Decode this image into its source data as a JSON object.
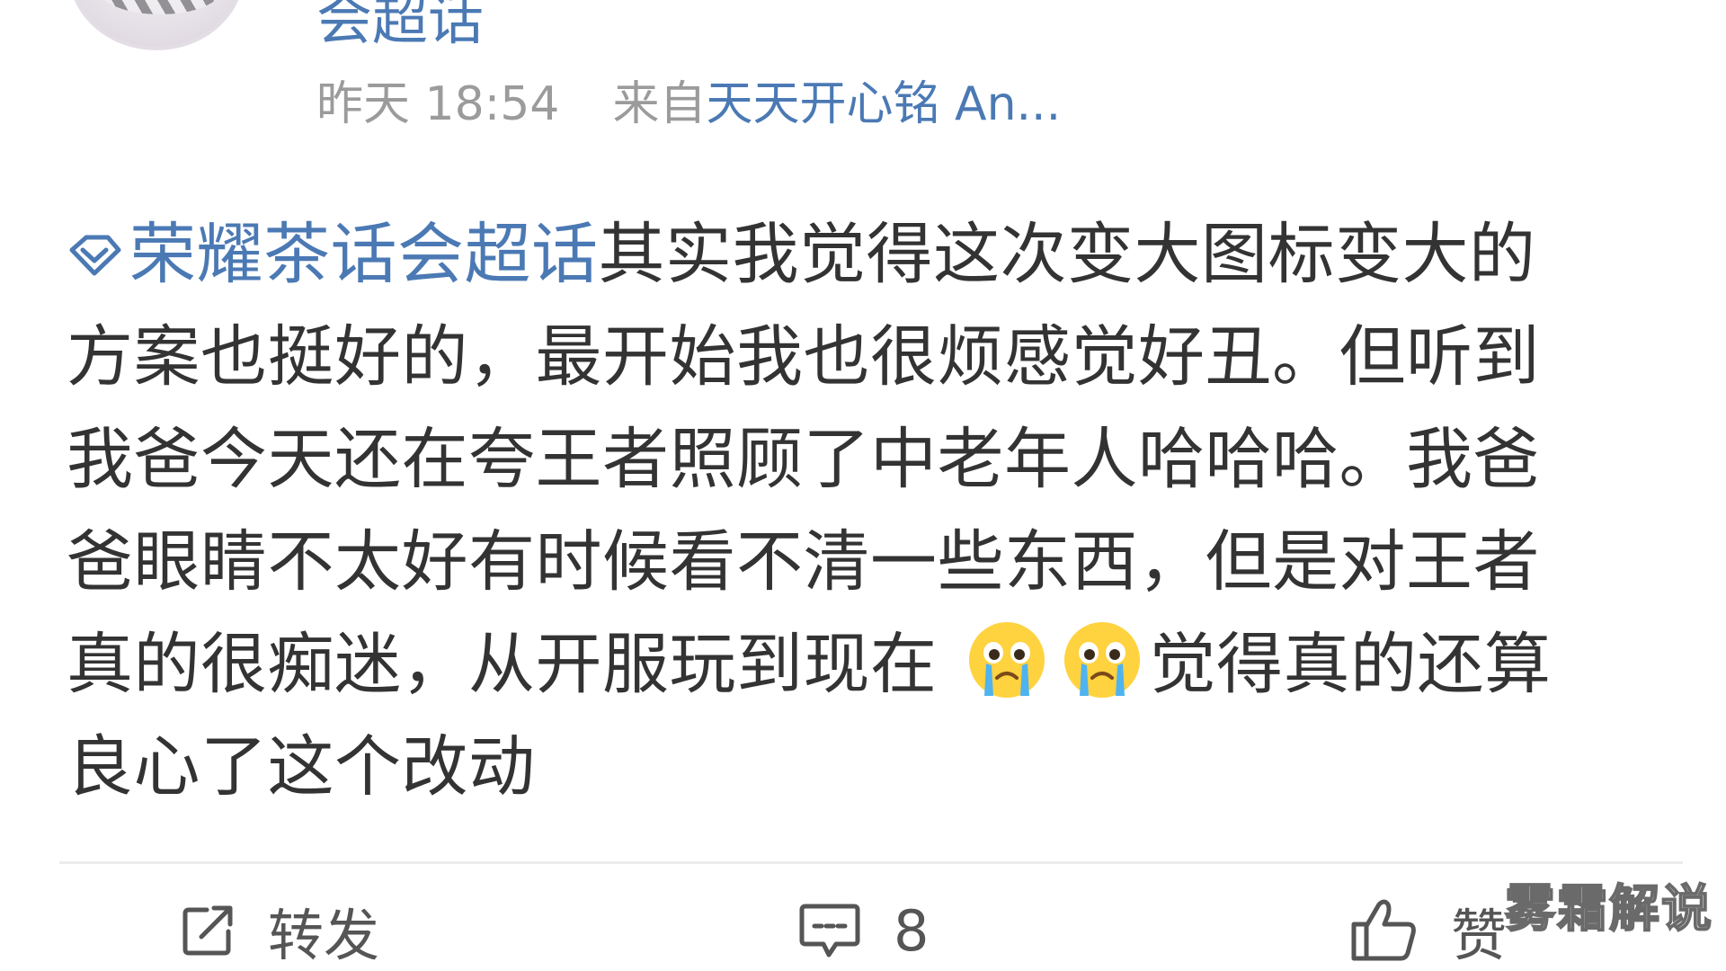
{
  "header": {
    "author_name": "会超话",
    "time": "昨天 18:54",
    "source_prefix": "来自",
    "source_name": "天天开心铭 An..."
  },
  "post": {
    "topic": "荣耀茶话会超话",
    "lines": [
      "其实我觉得这次变大图标变大的",
      "方案也挺好的，最开始我也很烦感觉好丑。但听到",
      "我爸今天还在夸王者照顾了中老年人哈哈哈。我爸",
      "爸眼睛不太好有时候看不清一些东西，但是对王者",
      "真的很痴迷，从开服玩到现在",
      "觉得真的还算",
      "良心了这个改动"
    ],
    "emoji": [
      "crying-face-icon",
      "crying-face-icon"
    ]
  },
  "actions": {
    "repost_label": "转发",
    "comment_count": "8",
    "like_label": "赞"
  },
  "watermark": "雾霜解说",
  "colors": {
    "link": "#4b79b4",
    "text": "#333333",
    "meta": "#9b9b9b",
    "divider": "#ececec"
  }
}
